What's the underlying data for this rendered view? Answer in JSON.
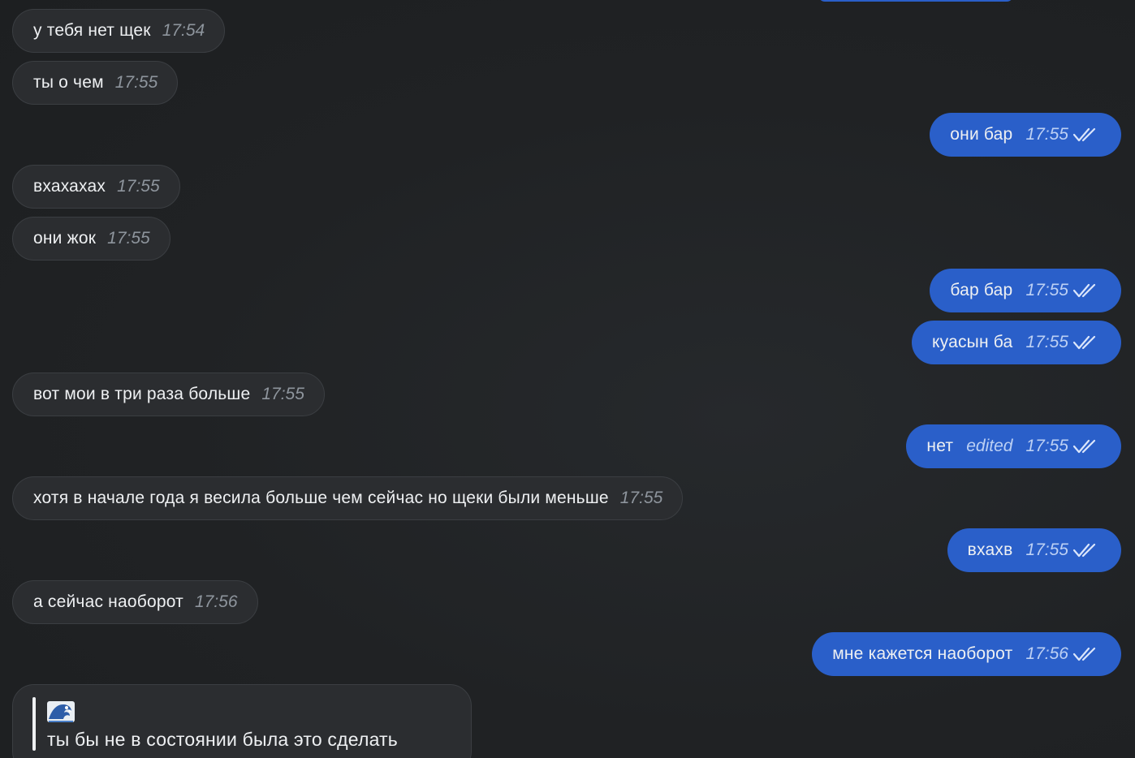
{
  "messages": [
    {
      "dir": "in",
      "text": "у тебя нет щек",
      "time": "17:54"
    },
    {
      "dir": "in",
      "text": "ты о чем",
      "time": "17:55"
    },
    {
      "dir": "out",
      "text": "они бар",
      "time": "17:55",
      "status": "read"
    },
    {
      "dir": "in",
      "text": "вхахахах",
      "time": "17:55"
    },
    {
      "dir": "in",
      "text": "они жок",
      "time": "17:55"
    },
    {
      "dir": "out",
      "text": "бар бар",
      "time": "17:55",
      "status": "read"
    },
    {
      "dir": "out",
      "text": "куасын ба",
      "time": "17:55",
      "status": "read"
    },
    {
      "dir": "in",
      "text": "вот мои в три раза больше",
      "time": "17:55"
    },
    {
      "dir": "out",
      "text": "нет",
      "edited_label": "edited",
      "time": "17:55",
      "status": "read"
    },
    {
      "dir": "in",
      "text": "хотя в начале года я весила больше чем сейчас но щеки были меньше",
      "time": "17:55"
    },
    {
      "dir": "out",
      "text": "вхахв",
      "time": "17:55",
      "status": "read"
    },
    {
      "dir": "in",
      "text": "а сейчас наоборот",
      "time": "17:56"
    },
    {
      "dir": "out",
      "text": "мне кажется наоборот",
      "time": "17:56",
      "status": "read"
    }
  ],
  "last_message": {
    "quote_icon": "wave-emoji-icon",
    "text": "ты бы не в состоянии была это сделать"
  },
  "colors": {
    "background": "#202224",
    "incoming_bubble": "#2b2d30",
    "outgoing_bubble": "#2a5fc9",
    "incoming_time": "#8e959d",
    "outgoing_time": "#bcd0f4"
  }
}
